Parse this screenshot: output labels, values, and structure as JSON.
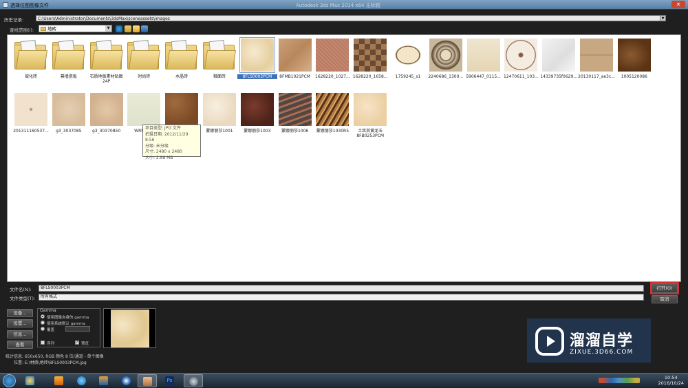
{
  "window": {
    "title": "选择位图图像文件",
    "center_title": "Autodesk 3ds Max 2014 x64  无标题",
    "close_label": "✕"
  },
  "history": {
    "label": "历史记录:",
    "path": "C:\\Users\\Administrator\\Documents\\3dsMax\\sceneassets\\images"
  },
  "look_in": {
    "label": "查找范围(I):",
    "value": "地砖"
  },
  "items": [
    {
      "name": "玻化砖",
      "kind": "folder",
      "style": "tile-grey"
    },
    {
      "name": "幕墙瓷板",
      "kind": "folder",
      "style": "tile-grey"
    },
    {
      "name": "石质地板素材贴图24P",
      "kind": "folder",
      "style": "tile-stone"
    },
    {
      "name": "时尚砖",
      "kind": "folder",
      "style": "tile-grey"
    },
    {
      "name": "水晶砖",
      "kind": "folder",
      "style": "tile-wood"
    },
    {
      "name": "釉面砖",
      "kind": "folder",
      "style": "plain"
    },
    {
      "name": "8FLS0002PCM",
      "kind": "image",
      "bg": "radial-gradient(ellipse at 40% 40%, #f6ead0, #e6cf9f 65%, #f1e0ba)",
      "selected": true
    },
    {
      "name": "8FMB1021PCM",
      "kind": "image",
      "bg": "linear-gradient(135deg, #caa27a, #b8875c 50%, #d5b08a)"
    },
    {
      "name": "1628220_1027...",
      "kind": "image",
      "bg": "repeating-linear-gradient(45deg, #c48870 0 2px, #b97a63 2px 4px)"
    },
    {
      "name": "1628220_1658...",
      "kind": "image",
      "bg": "repeating-conic-gradient(#6b4a32 0 25%, #a37a55 0 50%) 0 0/16px 16px"
    },
    {
      "name": "1759245_s1",
      "kind": "image",
      "bg": "radial-gradient(ellipse 60% 45%, #f3e5c7 55%, #5a3a20 58%, #f3e5c7 64%, #ffffff 66%)"
    },
    {
      "name": "2240686_1300...",
      "kind": "image",
      "bg": "radial-gradient(circle, #e8dcc0 20%, #6b5a4a 24%, #d8c8a8 30%, #6b5a4a 40%, #cfbf9f 44%, #5a4535 60%, #c8b89a 64%)"
    },
    {
      "name": "5906447_0115...",
      "kind": "image",
      "bg": "linear-gradient(#efe5cf, #e5d6b4)"
    },
    {
      "name": "12470611_103...",
      "kind": "image",
      "bg": "radial-gradient(circle, #8a5a40 8%, #f4ece0 12%, #f4ece0 60%, #7a4a35 62%, #f4ece0 66%)"
    },
    {
      "name": "14339735f0629...",
      "kind": "image",
      "bg": "linear-gradient(135deg, #f2f2f2, #dedede 60%, #f7f7f7)"
    },
    {
      "name": "20130117_ae3c...",
      "kind": "image",
      "bg": "linear-gradient(#c8a882 49%, #7a5a40 50%, #c8a882 51%)"
    },
    {
      "name": "1005120086",
      "kind": "image",
      "bg": "radial-gradient(ellipse at 40% 50%, #8a5a30, #5a3415 70%)"
    },
    {
      "name": "201311160537...",
      "kind": "image",
      "bg": "radial-gradient(circle, #b8906a 4%, #f0e2cc 8%)"
    },
    {
      "name": "g3_3037085",
      "kind": "image",
      "bg": "radial-gradient(ellipse, #e4cfb4, #d8bd9b 70%)"
    },
    {
      "name": "g3_30370850",
      "kind": "image",
      "bg": "radial-gradient(ellipse, #e2c9a8, #d2b18e 70%)"
    },
    {
      "name": "WRMP0...",
      "kind": "image",
      "bg": "linear-gradient(#e8ead8, #dfe2cc)"
    },
    {
      "name": "",
      "kind": "image",
      "bg": "radial-gradient(ellipse at 30% 30%, #a06a3e, #7a4a25 70%)"
    },
    {
      "name": "蒙娜丽莎1001",
      "kind": "image",
      "bg": "radial-gradient(ellipse at 40% 40%, #f8efe0, #ead9bf 70%)"
    },
    {
      "name": "蒙娜丽莎1003",
      "kind": "image",
      "bg": "radial-gradient(ellipse at 40% 40%, #7a3c2c, #4d2218 70%)"
    },
    {
      "name": "蒙娜丽莎1006",
      "kind": "image",
      "bg": "repeating-linear-gradient(160deg, #6b4030 0 3px, #a0705a 3px 6px, #3c4a50 6px 8px)"
    },
    {
      "name": "蒙娜丽莎1030R5",
      "kind": "image",
      "bg": "repeating-linear-gradient(120deg, #5a3015 0 3px, #b07a40 3px 6px, #d8a868 6px 8px)"
    },
    {
      "name": "土耳其黄龙玉8FB0253PCM",
      "kind": "image",
      "bg": "radial-gradient(ellipse at 40% 40%, #f6e4c6, #ebcfa2 70%)"
    }
  ],
  "tooltip": {
    "lines": [
      "项目类型: JPG 文件",
      "拍摄日期: 2012/11/29 8:56",
      "分级: 未分级",
      "尺寸: 2480 x 2480",
      "大小: 2.88 MB"
    ]
  },
  "file_name": {
    "label": "文件名(N):",
    "value": "8FLS0003PCM"
  },
  "file_type": {
    "label": "文件类型(T):",
    "value": "所有格式"
  },
  "buttons": {
    "open": "打开(O)",
    "cancel": "取消",
    "setup": "设备...",
    "settings": "设置...",
    "info": "信息...",
    "view": "查看"
  },
  "gamma": {
    "title": "Gamma",
    "opt1": "使用图像自身的 gamma",
    "opt2": "使用系统默认 gamma",
    "opt3": "覆盖",
    "override_value": "",
    "sequence": "序列",
    "preview": "预览"
  },
  "stats": {
    "line1": "统计信息: 650x650, RGB 颜色 8 位/通道 - 单个图像",
    "line2": "位置: E:\\材质\\地砖\\8FLS0003PCM.jpg"
  },
  "taskbar": {
    "time": "10:54",
    "date": "2016/10/24",
    "apps": [
      "media-player",
      "ie",
      "qq-game",
      "sogou",
      "3dsmax-file",
      "photoshop",
      "3dsmax"
    ]
  },
  "watermark": {
    "title": "溜溜自学",
    "subtitle": "ZIXUE.3D66.COM"
  }
}
